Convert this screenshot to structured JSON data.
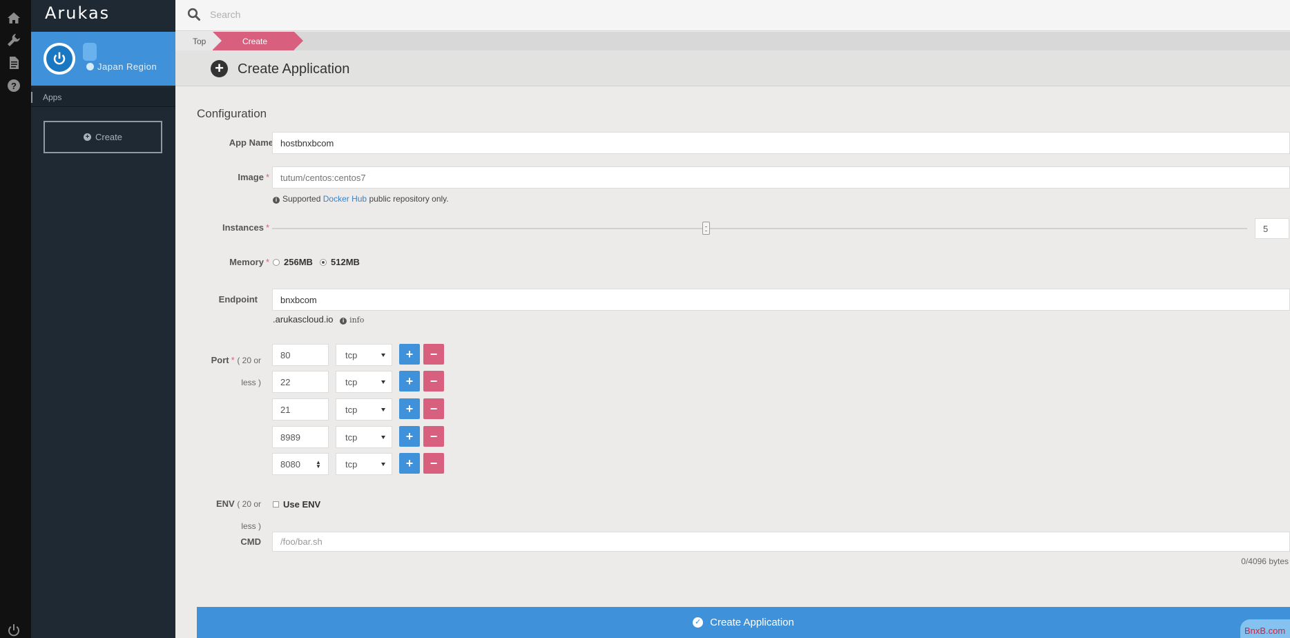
{
  "app": {
    "logo_text": "Arukas"
  },
  "rail": {
    "icons": [
      "home-icon",
      "wrench-icon",
      "document-icon",
      "help-icon",
      "power-icon"
    ]
  },
  "sidebar": {
    "region": "Japan Region",
    "section_label": "Apps",
    "create_button": "Create"
  },
  "search": {
    "placeholder": "Search"
  },
  "breadcrumb": {
    "items": [
      "Top",
      "Create"
    ]
  },
  "header": {
    "title": "Create Application"
  },
  "form": {
    "section_title": "Configuration",
    "app_name": {
      "label": "App Name",
      "value": "hostbnxbcom"
    },
    "image": {
      "label": "Image",
      "placeholder": "tutum/centos:centos7",
      "hint_prefix": "Supported",
      "hint_link": "Docker Hub",
      "hint_suffix": "public repository only."
    },
    "instances": {
      "label": "Instances",
      "value": "5",
      "slider_fraction": 0.445
    },
    "memory": {
      "label": "Memory",
      "options": [
        "256MB",
        "512MB"
      ],
      "selected": "512MB"
    },
    "endpoint": {
      "label": "Endpoint",
      "value": "bnxbcom",
      "suffix": ".arukascloud.io",
      "info_label": "info"
    },
    "port": {
      "label": "Port",
      "sublabel": "( 20 or less )",
      "rows": [
        {
          "number": "80",
          "protocol": "tcp"
        },
        {
          "number": "22",
          "protocol": "tcp"
        },
        {
          "number": "21",
          "protocol": "tcp"
        },
        {
          "number": "8989",
          "protocol": "tcp"
        },
        {
          "number": "8080",
          "protocol": "tcp"
        }
      ]
    },
    "env": {
      "label": "ENV",
      "sublabel": "( 20 or less )",
      "checkbox_label": "Use ENV"
    },
    "cmd": {
      "label": "CMD",
      "placeholder": "/foo/bar.sh",
      "byte_count": "0/4096 bytes"
    },
    "submit_label": "Create Application"
  },
  "overlay": {
    "watermark": "BnxB.com"
  },
  "colors": {
    "accent_blue": "#3f92d9",
    "accent_pink": "#d95f7f",
    "sidebar_bg": "#1e2933",
    "rail_bg": "#111111"
  }
}
